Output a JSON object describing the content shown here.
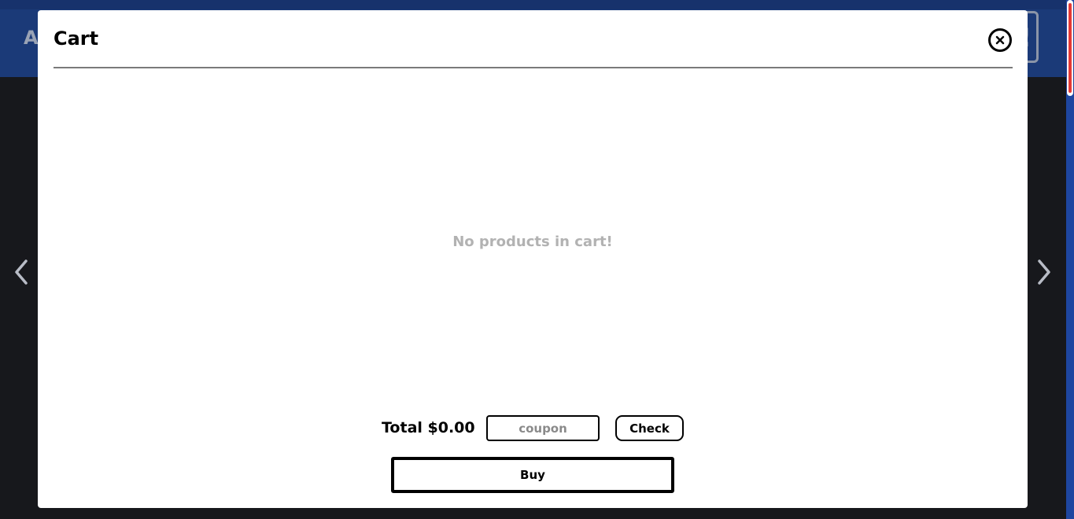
{
  "background": {
    "logo_text": "Ac",
    "cart_glyph": "!",
    "header_color": "#1b3a78",
    "page_color": "#17181c"
  },
  "modal": {
    "title": "Cart",
    "close_icon": "close-circle-icon",
    "empty_message": "No products in cart!",
    "total_label": "Total $0.00",
    "coupon": {
      "value": "",
      "placeholder": "coupon"
    },
    "check_label": "Check",
    "buy_label": "Buy"
  },
  "scrollbar": {
    "thumb_color": "#e53935",
    "track_color": "#1e46a0"
  }
}
